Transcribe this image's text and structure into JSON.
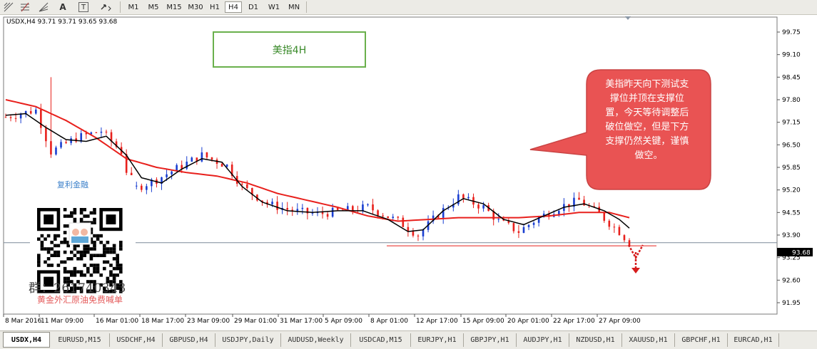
{
  "toolbar": {
    "tool_icons": [
      "fibonacci-icon",
      "fibo-expansion-icon",
      "text-icon",
      "text-label-icon",
      "arrows-icon"
    ],
    "tool_labels": [
      "",
      "",
      "A",
      "T",
      ""
    ],
    "timeframes": [
      "M1",
      "M5",
      "M15",
      "M30",
      "H1",
      "H4",
      "D1",
      "W1",
      "MN"
    ],
    "active_timeframe": "H4"
  },
  "chart_header": "USDX,H4  93.71 93.71 93.65 93.68",
  "annotation_box": {
    "text": "美指4H"
  },
  "callout": {
    "lines": [
      "美指昨天向下测试支",
      "撑位并顶在支撑位",
      "置，今天等待调整后",
      "破位做空，但是下方",
      "支撑仍然关键，谨慎",
      "做空。"
    ]
  },
  "qr_block": {
    "title": "复利金融",
    "group": "群：261740343",
    "subtitle": "黄金外汇原油免费喊单"
  },
  "tabs": [
    "USDX,H4",
    "EURUSD,M15",
    "USDCHF,H4",
    "GBPUSD,H4",
    "USDJPY,Daily",
    "AUDUSD,Weekly",
    "USDCAD,M15",
    "EURJPY,H1",
    "GBPJPY,H1",
    "AUDJPY,H1",
    "NZDUSD,H1",
    "XAUUSD,H1",
    "GBPCHF,H1",
    "EURCAD,H1"
  ],
  "active_tab": "USDX,H4",
  "colors": {
    "bull": "#1a3fd1",
    "bear": "#e8201c",
    "ma_fast": "#000000",
    "ma_slow": "#e8201c",
    "price_line": "#7b8a99",
    "callout_fill": "#e95353"
  },
  "chart_data": {
    "type": "candlestick",
    "symbol": "USDX",
    "timeframe": "H4",
    "ohlc_header": {
      "open": 93.71,
      "high": 93.71,
      "low": 93.65,
      "close": 93.68
    },
    "current_price": "93.68",
    "y_ticks": [
      "99.75",
      "99.10",
      "98.45",
      "97.80",
      "97.15",
      "96.50",
      "95.85",
      "95.20",
      "94.55",
      "93.90",
      "93.25",
      "92.60",
      "91.95"
    ],
    "ylim": [
      91.95,
      99.75
    ],
    "x_ticks": [
      "8 Mar 2016",
      "11 Mar 09:00",
      "16 Mar 01:00",
      "18 Mar 17:00",
      "23 Mar 09:00",
      "29 Mar 01:00",
      "31 Mar 17:00",
      "5 Apr 09:00",
      "8 Apr 01:00",
      "12 Apr 17:00",
      "15 Apr 09:00",
      "20 Apr 01:00",
      "22 Apr 17:00",
      "27 Apr 09:00"
    ],
    "close_path": [
      [
        0,
        97.3
      ],
      [
        6,
        97.5
      ],
      [
        9,
        96.3
      ],
      [
        14,
        96.7
      ],
      [
        19,
        96.9
      ],
      [
        23,
        96.3
      ],
      [
        25,
        95.2
      ],
      [
        30,
        95.5
      ],
      [
        35,
        95.9
      ],
      [
        39,
        96.2
      ],
      [
        44,
        95.9
      ],
      [
        47,
        95.3
      ],
      [
        52,
        94.8
      ],
      [
        57,
        94.6
      ],
      [
        62,
        94.5
      ],
      [
        67,
        94.6
      ],
      [
        72,
        94.7
      ],
      [
        78,
        94.3
      ],
      [
        82,
        93.9
      ],
      [
        86,
        94.5
      ],
      [
        90,
        95.0
      ],
      [
        95,
        94.7
      ],
      [
        98,
        94.3
      ],
      [
        102,
        94.0
      ],
      [
        106,
        94.4
      ],
      [
        110,
        94.7
      ],
      [
        114,
        94.9
      ],
      [
        118,
        94.5
      ],
      [
        122,
        94.0
      ],
      [
        124,
        93.68
      ]
    ],
    "ma_fast": [
      [
        0,
        97.35
      ],
      [
        4,
        97.4
      ],
      [
        8,
        97.0
      ],
      [
        12,
        96.65
      ],
      [
        16,
        96.6
      ],
      [
        20,
        96.75
      ],
      [
        24,
        96.2
      ],
      [
        27,
        95.55
      ],
      [
        31,
        95.4
      ],
      [
        35,
        95.8
      ],
      [
        39,
        96.1
      ],
      [
        43,
        96.0
      ],
      [
        47,
        95.3
      ],
      [
        51,
        94.85
      ],
      [
        56,
        94.6
      ],
      [
        61,
        94.55
      ],
      [
        66,
        94.6
      ],
      [
        71,
        94.6
      ],
      [
        76,
        94.35
      ],
      [
        80,
        94.0
      ],
      [
        83,
        94.05
      ],
      [
        87,
        94.6
      ],
      [
        91,
        94.95
      ],
      [
        95,
        94.8
      ],
      [
        99,
        94.35
      ],
      [
        103,
        94.2
      ],
      [
        107,
        94.45
      ],
      [
        111,
        94.7
      ],
      [
        115,
        94.8
      ],
      [
        119,
        94.6
      ],
      [
        122,
        94.35
      ],
      [
        124,
        94.1
      ]
    ],
    "ma_slow": [
      [
        0,
        97.8
      ],
      [
        6,
        97.6
      ],
      [
        12,
        97.2
      ],
      [
        18,
        96.7
      ],
      [
        24,
        96.1
      ],
      [
        30,
        95.85
      ],
      [
        36,
        95.7
      ],
      [
        42,
        95.6
      ],
      [
        48,
        95.4
      ],
      [
        54,
        95.1
      ],
      [
        60,
        94.9
      ],
      [
        66,
        94.7
      ],
      [
        72,
        94.45
      ],
      [
        78,
        94.3
      ],
      [
        84,
        94.35
      ],
      [
        90,
        94.4
      ],
      [
        96,
        94.4
      ],
      [
        102,
        94.4
      ],
      [
        108,
        94.45
      ],
      [
        114,
        94.55
      ],
      [
        120,
        94.55
      ],
      [
        124,
        94.4
      ]
    ],
    "support_line": 93.65,
    "n_candles": 125
  }
}
